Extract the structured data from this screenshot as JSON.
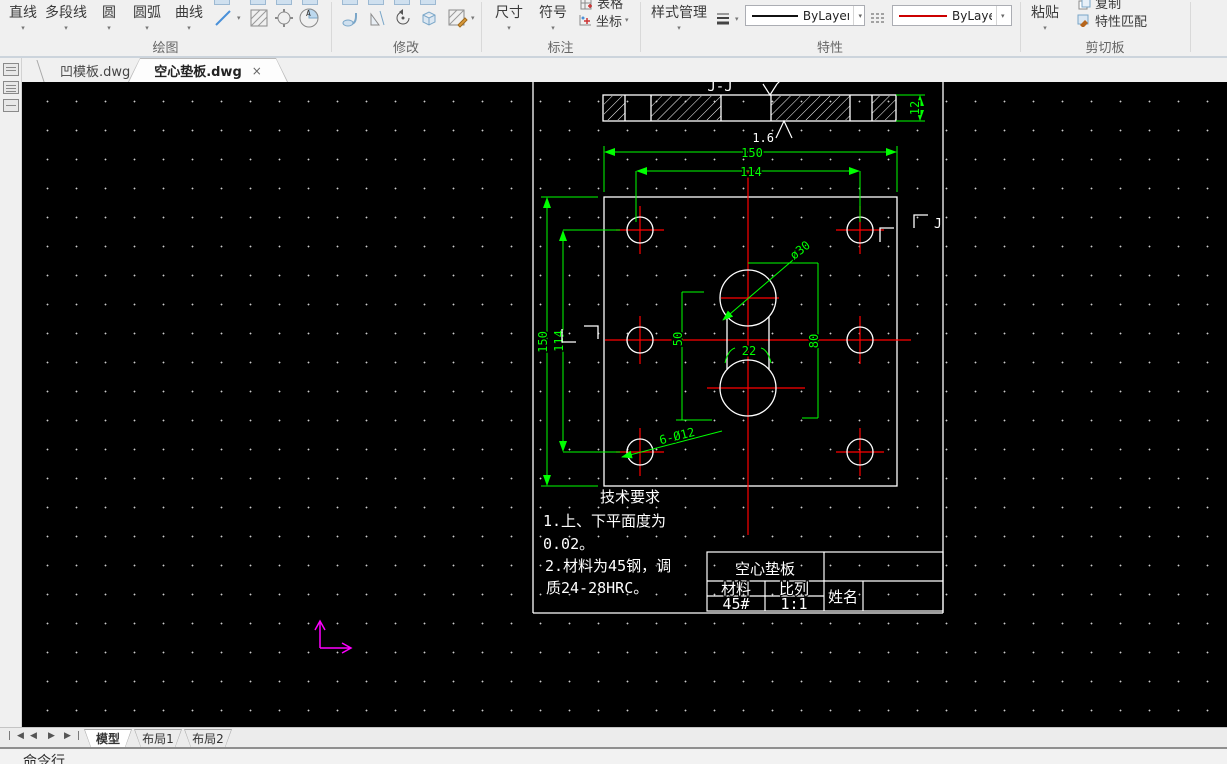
{
  "ribbon": {
    "draw": {
      "label": "绘图",
      "line": "直线",
      "pline": "多段线",
      "circle": "圆",
      "arc": "圆弧",
      "curve": "曲线"
    },
    "modify": {
      "label": "修改"
    },
    "annotate": {
      "label": "标注",
      "dim": "尺寸",
      "symbol": "符号",
      "table": "表格",
      "coord": "坐标"
    },
    "props": {
      "label": "特性",
      "style": "样式管理",
      "lineweight_value": "ByLayer",
      "color_value": "ByLayer"
    },
    "clip": {
      "label": "剪切板",
      "paste": "粘贴",
      "copy": "复制",
      "match": "特性匹配"
    },
    "caret": "▾"
  },
  "tabs": {
    "tab1": "凹模板.dwg",
    "tab2": "空心垫板.dwg",
    "close": "×"
  },
  "drawing": {
    "section_label": "J-J",
    "dim_thickness": "12",
    "roughness": "1.6",
    "dim_width": "150",
    "dim_holespan": "114",
    "dim_height": "150",
    "dim_holespan_v": "114",
    "dim_50": "50",
    "dim_80": "80",
    "dim_22": "22",
    "dim_dia": "ø30",
    "dim_holes": "6-Ø12",
    "section_j": "J",
    "tech_title": "技术要求",
    "tech_1": "1.上、下平面度为",
    "tech_2": "0.02。",
    "tech_3": "2.材料为45钢，调",
    "tech_4": "质24-28HRC。",
    "tb_title": "空心垫板",
    "tb_material_label": "材料",
    "tb_scale_label": "比列",
    "tb_material": "45#",
    "tb_scale": "1:1",
    "tb_name": "姓名"
  },
  "model_tabs": {
    "model": "模型",
    "layout1": "布局1",
    "layout2": "布局2"
  },
  "status": {
    "command": "命令行"
  },
  "nav": {
    "first": "|◀",
    "prev": "◀",
    "next": "▶",
    "last": "▶|"
  },
  "colors": {
    "dimension": "#00ff00",
    "centerline": "#ff0000",
    "outline": "#ffffff",
    "ucs": "#ff00ff"
  }
}
